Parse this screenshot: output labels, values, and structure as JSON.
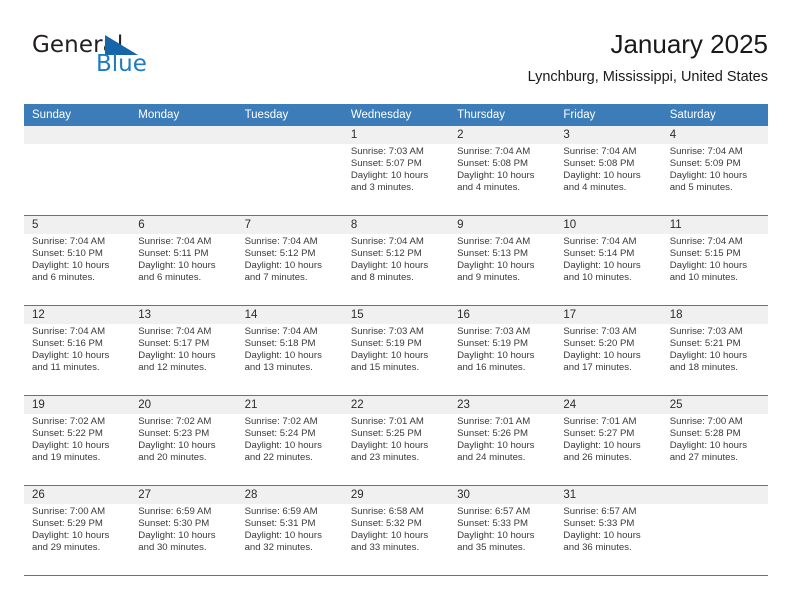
{
  "brand": {
    "name_part1": "General",
    "name_part2": "Blue",
    "triangle_color": "#1565a8",
    "blue_color": "#1d7cc4"
  },
  "header": {
    "title": "January 2025",
    "location": "Lynchburg, Mississippi, United States"
  },
  "theme": {
    "header_band": "#3b7cb9",
    "date_band": "#f0f0f0",
    "rule": "#3b7cb9"
  },
  "weekdays": [
    "Sunday",
    "Monday",
    "Tuesday",
    "Wednesday",
    "Thursday",
    "Friday",
    "Saturday"
  ],
  "weeks": [
    {
      "days": [
        {
          "num": "",
          "sunrise": "",
          "sunset": "",
          "daylight": ""
        },
        {
          "num": "",
          "sunrise": "",
          "sunset": "",
          "daylight": ""
        },
        {
          "num": "",
          "sunrise": "",
          "sunset": "",
          "daylight": ""
        },
        {
          "num": "1",
          "sunrise": "Sunrise: 7:03 AM",
          "sunset": "Sunset: 5:07 PM",
          "daylight": "Daylight: 10 hours and 3 minutes."
        },
        {
          "num": "2",
          "sunrise": "Sunrise: 7:04 AM",
          "sunset": "Sunset: 5:08 PM",
          "daylight": "Daylight: 10 hours and 4 minutes."
        },
        {
          "num": "3",
          "sunrise": "Sunrise: 7:04 AM",
          "sunset": "Sunset: 5:08 PM",
          "daylight": "Daylight: 10 hours and 4 minutes."
        },
        {
          "num": "4",
          "sunrise": "Sunrise: 7:04 AM",
          "sunset": "Sunset: 5:09 PM",
          "daylight": "Daylight: 10 hours and 5 minutes."
        }
      ]
    },
    {
      "days": [
        {
          "num": "5",
          "sunrise": "Sunrise: 7:04 AM",
          "sunset": "Sunset: 5:10 PM",
          "daylight": "Daylight: 10 hours and 6 minutes."
        },
        {
          "num": "6",
          "sunrise": "Sunrise: 7:04 AM",
          "sunset": "Sunset: 5:11 PM",
          "daylight": "Daylight: 10 hours and 6 minutes."
        },
        {
          "num": "7",
          "sunrise": "Sunrise: 7:04 AM",
          "sunset": "Sunset: 5:12 PM",
          "daylight": "Daylight: 10 hours and 7 minutes."
        },
        {
          "num": "8",
          "sunrise": "Sunrise: 7:04 AM",
          "sunset": "Sunset: 5:12 PM",
          "daylight": "Daylight: 10 hours and 8 minutes."
        },
        {
          "num": "9",
          "sunrise": "Sunrise: 7:04 AM",
          "sunset": "Sunset: 5:13 PM",
          "daylight": "Daylight: 10 hours and 9 minutes."
        },
        {
          "num": "10",
          "sunrise": "Sunrise: 7:04 AM",
          "sunset": "Sunset: 5:14 PM",
          "daylight": "Daylight: 10 hours and 10 minutes."
        },
        {
          "num": "11",
          "sunrise": "Sunrise: 7:04 AM",
          "sunset": "Sunset: 5:15 PM",
          "daylight": "Daylight: 10 hours and 10 minutes."
        }
      ]
    },
    {
      "days": [
        {
          "num": "12",
          "sunrise": "Sunrise: 7:04 AM",
          "sunset": "Sunset: 5:16 PM",
          "daylight": "Daylight: 10 hours and 11 minutes."
        },
        {
          "num": "13",
          "sunrise": "Sunrise: 7:04 AM",
          "sunset": "Sunset: 5:17 PM",
          "daylight": "Daylight: 10 hours and 12 minutes."
        },
        {
          "num": "14",
          "sunrise": "Sunrise: 7:04 AM",
          "sunset": "Sunset: 5:18 PM",
          "daylight": "Daylight: 10 hours and 13 minutes."
        },
        {
          "num": "15",
          "sunrise": "Sunrise: 7:03 AM",
          "sunset": "Sunset: 5:19 PM",
          "daylight": "Daylight: 10 hours and 15 minutes."
        },
        {
          "num": "16",
          "sunrise": "Sunrise: 7:03 AM",
          "sunset": "Sunset: 5:19 PM",
          "daylight": "Daylight: 10 hours and 16 minutes."
        },
        {
          "num": "17",
          "sunrise": "Sunrise: 7:03 AM",
          "sunset": "Sunset: 5:20 PM",
          "daylight": "Daylight: 10 hours and 17 minutes."
        },
        {
          "num": "18",
          "sunrise": "Sunrise: 7:03 AM",
          "sunset": "Sunset: 5:21 PM",
          "daylight": "Daylight: 10 hours and 18 minutes."
        }
      ]
    },
    {
      "days": [
        {
          "num": "19",
          "sunrise": "Sunrise: 7:02 AM",
          "sunset": "Sunset: 5:22 PM",
          "daylight": "Daylight: 10 hours and 19 minutes."
        },
        {
          "num": "20",
          "sunrise": "Sunrise: 7:02 AM",
          "sunset": "Sunset: 5:23 PM",
          "daylight": "Daylight: 10 hours and 20 minutes."
        },
        {
          "num": "21",
          "sunrise": "Sunrise: 7:02 AM",
          "sunset": "Sunset: 5:24 PM",
          "daylight": "Daylight: 10 hours and 22 minutes."
        },
        {
          "num": "22",
          "sunrise": "Sunrise: 7:01 AM",
          "sunset": "Sunset: 5:25 PM",
          "daylight": "Daylight: 10 hours and 23 minutes."
        },
        {
          "num": "23",
          "sunrise": "Sunrise: 7:01 AM",
          "sunset": "Sunset: 5:26 PM",
          "daylight": "Daylight: 10 hours and 24 minutes."
        },
        {
          "num": "24",
          "sunrise": "Sunrise: 7:01 AM",
          "sunset": "Sunset: 5:27 PM",
          "daylight": "Daylight: 10 hours and 26 minutes."
        },
        {
          "num": "25",
          "sunrise": "Sunrise: 7:00 AM",
          "sunset": "Sunset: 5:28 PM",
          "daylight": "Daylight: 10 hours and 27 minutes."
        }
      ]
    },
    {
      "days": [
        {
          "num": "26",
          "sunrise": "Sunrise: 7:00 AM",
          "sunset": "Sunset: 5:29 PM",
          "daylight": "Daylight: 10 hours and 29 minutes."
        },
        {
          "num": "27",
          "sunrise": "Sunrise: 6:59 AM",
          "sunset": "Sunset: 5:30 PM",
          "daylight": "Daylight: 10 hours and 30 minutes."
        },
        {
          "num": "28",
          "sunrise": "Sunrise: 6:59 AM",
          "sunset": "Sunset: 5:31 PM",
          "daylight": "Daylight: 10 hours and 32 minutes."
        },
        {
          "num": "29",
          "sunrise": "Sunrise: 6:58 AM",
          "sunset": "Sunset: 5:32 PM",
          "daylight": "Daylight: 10 hours and 33 minutes."
        },
        {
          "num": "30",
          "sunrise": "Sunrise: 6:57 AM",
          "sunset": "Sunset: 5:33 PM",
          "daylight": "Daylight: 10 hours and 35 minutes."
        },
        {
          "num": "31",
          "sunrise": "Sunrise: 6:57 AM",
          "sunset": "Sunset: 5:33 PM",
          "daylight": "Daylight: 10 hours and 36 minutes."
        },
        {
          "num": "",
          "sunrise": "",
          "sunset": "",
          "daylight": ""
        }
      ]
    }
  ]
}
